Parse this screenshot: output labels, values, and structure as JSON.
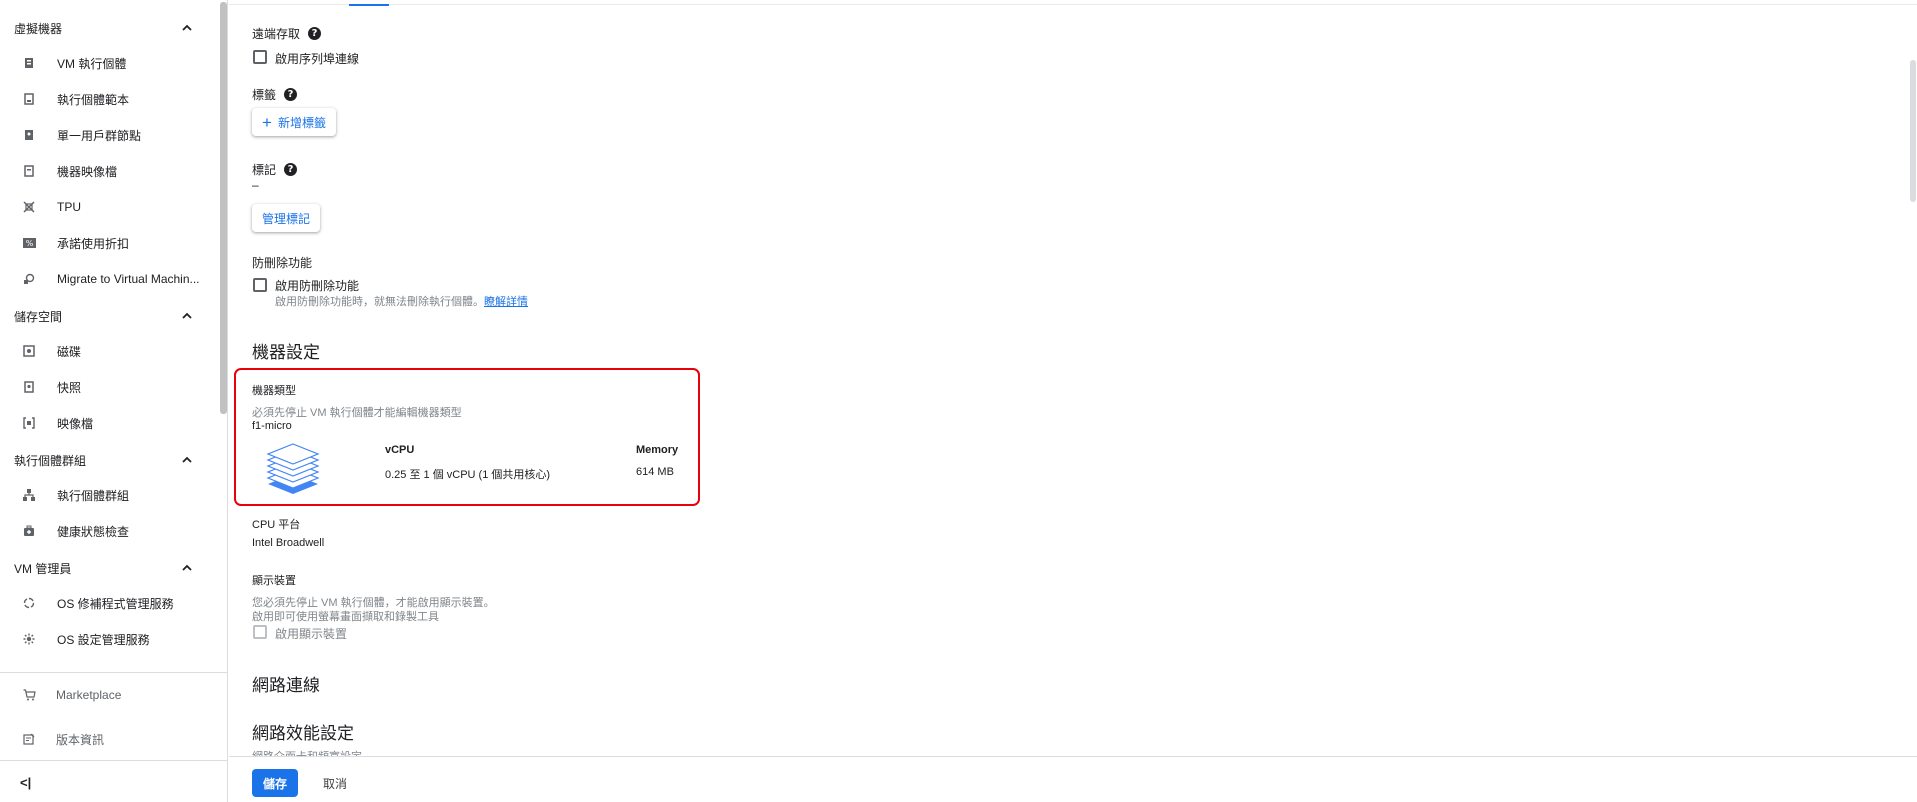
{
  "sidebar": {
    "sections": [
      {
        "title": "虛擬機器",
        "items": [
          {
            "label": "VM 執行個體",
            "icon": "vm-instance-icon"
          },
          {
            "label": "執行個體範本",
            "icon": "instance-template-icon"
          },
          {
            "label": "單一用戶群節點",
            "icon": "sole-tenant-node-icon"
          },
          {
            "label": "機器映像檔",
            "icon": "machine-image-icon"
          },
          {
            "label": "TPU",
            "icon": "tpu-icon"
          },
          {
            "label": "承諾使用折扣",
            "icon": "discount-icon"
          },
          {
            "label": "Migrate to Virtual Machin...",
            "icon": "migrate-icon"
          }
        ]
      },
      {
        "title": "儲存空間",
        "items": [
          {
            "label": "磁碟",
            "icon": "disk-icon"
          },
          {
            "label": "快照",
            "icon": "snapshot-icon"
          },
          {
            "label": "映像檔",
            "icon": "image-icon"
          }
        ]
      },
      {
        "title": "執行個體群組",
        "items": [
          {
            "label": "執行個體群組",
            "icon": "instance-group-icon"
          },
          {
            "label": "健康狀態檢查",
            "icon": "health-check-icon"
          }
        ]
      },
      {
        "title": "VM 管理員",
        "items": [
          {
            "label": "OS 修補程式管理服務",
            "icon": "os-patch-icon"
          },
          {
            "label": "OS 設定管理服務",
            "icon": "os-config-icon"
          }
        ]
      }
    ],
    "marketplace": "Marketplace",
    "release_notes": "版本資訊",
    "collapse_label": "<|"
  },
  "form": {
    "serial_port": {
      "label": "遠端存取",
      "checkbox": "啟用序列埠連線"
    },
    "labels": {
      "label": "標籤",
      "add_button": "新增標籤"
    },
    "tags": {
      "label": "標記",
      "value": "–",
      "manage_button": "管理標記"
    },
    "deletion_protection": {
      "label": "防刪除功能",
      "checkbox": "啟用防刪除功能",
      "hint": "啟用防刪除功能時，就無法刪除執行個體。",
      "learn_more": "瞭解詳情"
    },
    "machine_config": {
      "heading": "機器設定",
      "machine_type_label": "機器類型",
      "machine_type_hint": "必須先停止 VM 執行個體才能編輯機器類型",
      "machine_type_value": "f1-micro",
      "vcpu_header": "vCPU",
      "vcpu_value": "0.25 至 1 個 vCPU (1 個共用核心)",
      "memory_header": "Memory",
      "memory_value": "614 MB",
      "cpu_platform_label": "CPU 平台",
      "cpu_platform_value": "Intel Broadwell",
      "display_label": "顯示裝置",
      "display_hint_1": "您必須先停止 VM 執行個體，才能啟用顯示裝置。",
      "display_hint_2": "啟用即可使用螢幕畫面擷取和錄製工具",
      "display_checkbox": "啟用顯示裝置"
    },
    "networking": {
      "heading": "網路連線",
      "perf_heading": "網路效能設定",
      "perf_hint": "網路介面卡和頻寬設定"
    }
  },
  "footer": {
    "save": "儲存",
    "cancel": "取消"
  },
  "colors": {
    "accent": "#1a73e8",
    "highlight_border": "#e8000b"
  }
}
